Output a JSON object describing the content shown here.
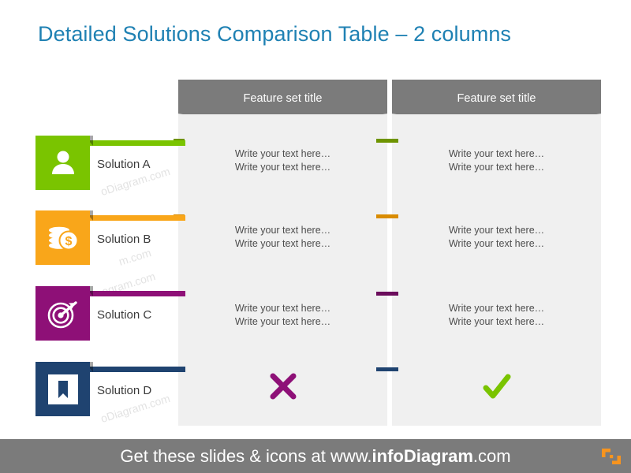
{
  "title": "Detailed Solutions Comparison Table – 2 columns",
  "title_color": "#1f81b3",
  "watermark": {
    "text_a": "oDiagram.com",
    "text_b": "m.com",
    "text_c": "ogram.com",
    "text_d": "oDiagram.com"
  },
  "solutions": [
    {
      "label": "Solution A",
      "color": "#7ac400",
      "icon": "person-icon"
    },
    {
      "label": "Solution B",
      "color": "#f9a61a",
      "icon": "coins-money-icon"
    },
    {
      "label": "Solution C",
      "color": "#8e1077",
      "icon": "target-arrow-icon"
    },
    {
      "label": "Solution D",
      "color": "#1f4370",
      "icon": "bookmark-icon"
    }
  ],
  "columns": [
    {
      "header": "Feature set title",
      "header_bg": "#7b7b7b",
      "body_bg": "#f0f0f0",
      "cells": [
        {
          "line1": "Write your text here…",
          "line2": "Write your text here…",
          "marker_color": "#6e9400"
        },
        {
          "line1": "Write your text here…",
          "line2": "Write your text here…",
          "marker_color": "#d98c00"
        },
        {
          "line1": "Write your text here…",
          "line2": "Write your text here…",
          "marker_color": "#6b0d5c"
        },
        {
          "symbol": "cross-mark",
          "symbol_color": "#8e1077"
        }
      ]
    },
    {
      "header": "Feature set title",
      "header_bg": "#7b7b7b",
      "body_bg": "#f0f0f0",
      "cells": [
        {
          "line1": "Write your text here…",
          "line2": "Write your text here…",
          "marker_color": "#6e9400"
        },
        {
          "line1": "Write your text here…",
          "line2": "Write your text here…",
          "marker_color": "#d98c00"
        },
        {
          "line1": "Write your text here…",
          "line2": "Write your text here…",
          "marker_color": "#6b0d5c"
        },
        {
          "symbol": "check-mark",
          "symbol_color": "#7ac400"
        }
      ]
    }
  ],
  "footer": {
    "prefix": "Get these slides & icons at www.",
    "brand": "infoDiagram",
    "suffix": ".com",
    "bg_color": "#7b7b7b",
    "logo_color": "#f7941e"
  }
}
